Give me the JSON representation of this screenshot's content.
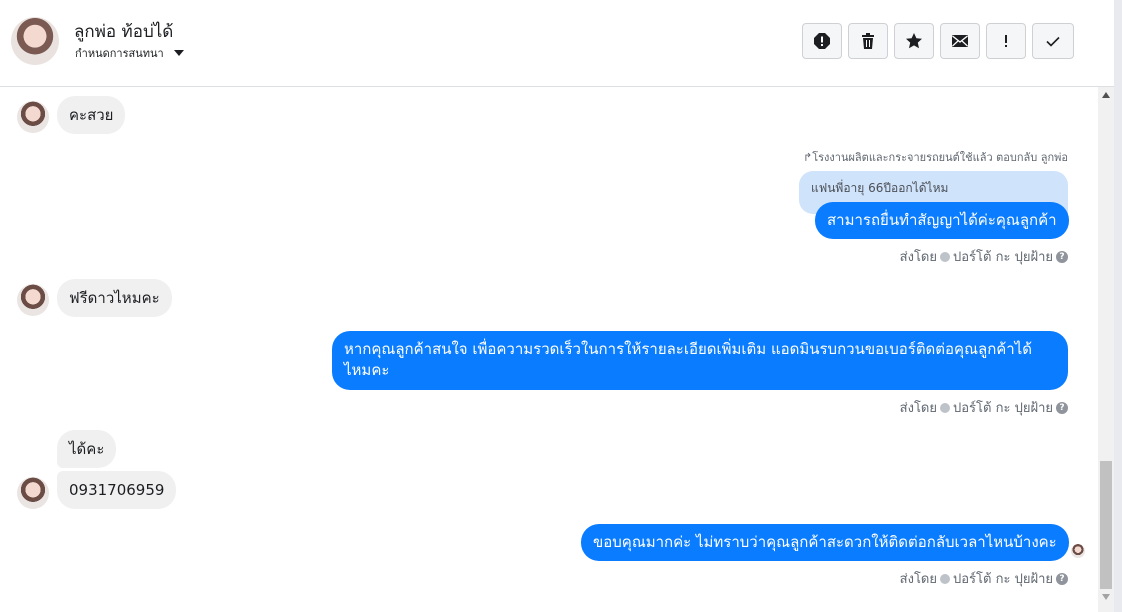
{
  "header": {
    "contact_name": "ลูกพ่อ ท้อบ่ได้",
    "assign_label": "กำหนดการสนทนา",
    "toolbar": [
      {
        "icon": "spam-alert-icon"
      },
      {
        "icon": "trash-icon"
      },
      {
        "icon": "star-icon"
      },
      {
        "icon": "mail-icon"
      },
      {
        "icon": "exclamation-icon"
      },
      {
        "icon": "check-icon"
      }
    ]
  },
  "messages": {
    "m1": "คะสวย",
    "reply_tag": "โรงงานผลิตและกระจายรถยนต์ใช้แล้ว ตอบกลับ ลูกพ่อ",
    "quoted": "แฟนพี่อายุ 66ปีออกได้ไหม",
    "m2": "สามารถยื่นทำสัญญาได้ค่ะคุณลูกค้า",
    "m3": "ฟรีดาวไหมคะ",
    "m4": "หากคุณลูกค้าสนใจ เพื่อความรวดเร็วในการให้รายละเอียดเพิ่มเติม แอดมินรบกวนขอเบอร์ติดต่อคุณลูกค้าได้ไหมคะ",
    "m5": "ได้คะ",
    "m6": "0931706959",
    "m7": "ขอบคุณมากค่ะ ไม่ทราบว่าคุณลูกค้าสะดวกให้ติดต่อกลับเวลาไหนบ้างคะ"
  },
  "sentby": {
    "prefix": "ส่งโดย",
    "name": "ปอร์โต้ กะ ปุยฝ้าย",
    "help": "?"
  },
  "colors": {
    "outgoing": "#0a7cff",
    "incoming": "#f0f0f0",
    "quoted": "#cfe3fb"
  }
}
